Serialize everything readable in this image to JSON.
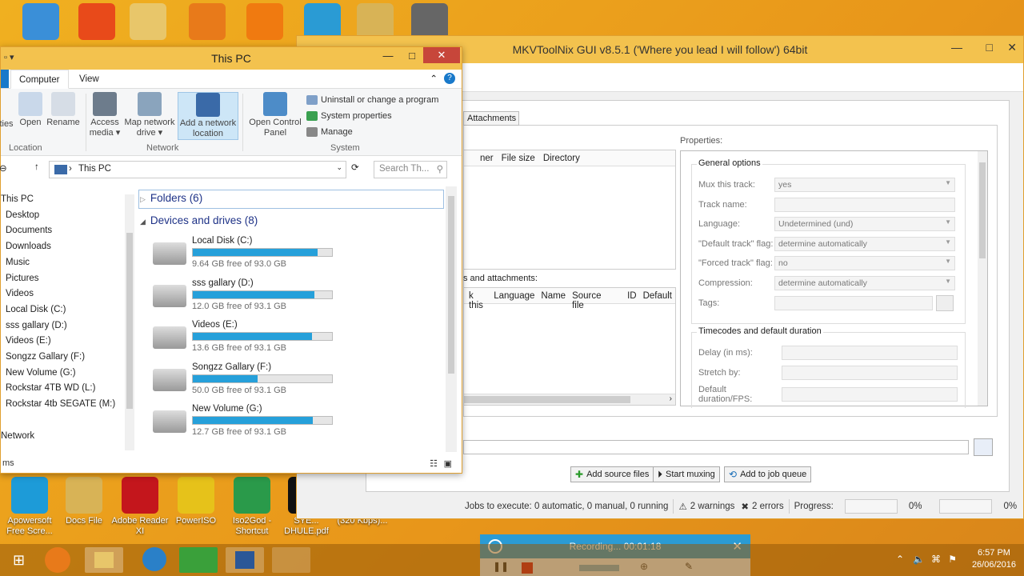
{
  "desktop_icons_top": [
    {
      "name": "computer-icon"
    },
    {
      "name": "rescue-icon"
    },
    {
      "name": "folder-icon"
    },
    {
      "name": "flash-icon"
    },
    {
      "name": "vlc-icon"
    },
    {
      "name": "lock-icon"
    },
    {
      "name": "folder-icon"
    },
    {
      "name": "film-reel-icon"
    }
  ],
  "desktop_icons_bottom": [
    {
      "label": "Apowersoft Free Scre...",
      "color": "#1d9bd8"
    },
    {
      "label": "Docs File",
      "color": "#d8b356"
    },
    {
      "label": "Adobe Reader XI",
      "color": "#c4161c"
    },
    {
      "label": "PowerISO",
      "color": "#e6c21a"
    },
    {
      "label": "Iso2God - Shortcut",
      "color": "#2a9a4a"
    },
    {
      "label": "SYE... DHULE.pdf",
      "color": "#111111"
    },
    {
      "label": "(320 Kbps)...",
      "color": "#d09a2a"
    }
  ],
  "mkv": {
    "title": "MKVToolNix GUI v8.5.1 ('Where you lead I will follow') 64bit",
    "tab_attachments": "Attachments",
    "files_headers": [
      "ner",
      "File size",
      "Directory"
    ],
    "tracks_label": "s and attachments:",
    "tracks_headers": [
      "k this",
      "Language",
      "Name",
      "Source file",
      "ID",
      "Default"
    ],
    "properties_label": "Properties:",
    "general_options": "General options",
    "rows": [
      {
        "label": "Mux this track:",
        "value": "yes",
        "dropdown": true
      },
      {
        "label": "Track name:",
        "value": "",
        "dropdown": false
      },
      {
        "label": "Language:",
        "value": "Undetermined (und)",
        "dropdown": true
      },
      {
        "label": "\"Default track\" flag:",
        "value": "determine automatically",
        "dropdown": true
      },
      {
        "label": "\"Forced track\" flag:",
        "value": "no",
        "dropdown": true
      },
      {
        "label": "Compression:",
        "value": "determine automatically",
        "dropdown": true
      },
      {
        "label": "Tags:",
        "value": "",
        "dropdown": false
      }
    ],
    "timecodes_title": "Timecodes and default duration",
    "timecode_rows": [
      {
        "label": "Delay (in ms):",
        "value": ""
      },
      {
        "label": "Stretch by:",
        "value": ""
      },
      {
        "label": "Default duration/FPS:",
        "value": ""
      }
    ],
    "btn_add_source": "Add source files",
    "btn_start_muxing": "Start muxing",
    "btn_add_queue": "Add to job queue",
    "status": {
      "jobs": "Jobs to execute:  0 automatic, 0 manual, 0 running",
      "warnings": "2 warnings",
      "errors": "2 errors",
      "progress_label": "Progress:",
      "progress1": "0%",
      "progress2": "0%"
    }
  },
  "explorer": {
    "title": "This PC",
    "tab_computer": "Computer",
    "tab_view": "View",
    "ribbon": {
      "properties": "ties",
      "open": "Open",
      "rename": "Rename",
      "access_media": "Access media ▾",
      "map_network": "Map network drive ▾",
      "add_network": "Add a network location",
      "open_control": "Open Control Panel",
      "uninstall": "Uninstall or change a program",
      "system_props": "System properties",
      "manage": "Manage",
      "group_location": "Location",
      "group_network": "Network",
      "group_system": "System"
    },
    "address": "This PC",
    "search_placeholder": "Search Th...",
    "nav": [
      "This PC",
      "Desktop",
      "Documents",
      "Downloads",
      "Music",
      "Pictures",
      "Videos",
      "Local Disk (C:)",
      "sss gallary (D:)",
      "Videos (E:)",
      "Songzz Gallary (F:)",
      "New Volume (G:)",
      "Rockstar 4TB WD (L:)",
      "Rockstar 4tb SEGATE (M:)",
      "",
      "Network"
    ],
    "folders_label": "Folders (6)",
    "devices_label": "Devices and drives (8)",
    "drives": [
      {
        "name": "Local Disk (C:)",
        "free": "9.64 GB free of 93.0 GB",
        "used": 0.896
      },
      {
        "name": "sss gallary (D:)",
        "free": "12.0 GB free of 93.1 GB",
        "used": 0.871
      },
      {
        "name": "Videos (E:)",
        "free": "13.6 GB free of 93.1 GB",
        "used": 0.854
      },
      {
        "name": "Songzz Gallary (F:)",
        "free": "50.0 GB free of 93.1 GB",
        "used": 0.463
      },
      {
        "name": "New Volume (G:)",
        "free": "12.7 GB free of 93.1 GB",
        "used": 0.864
      }
    ],
    "status_text": "ms"
  },
  "recording": {
    "text": "Recording... 00:01:18"
  },
  "tray": {
    "time": "6:57 PM",
    "date": "26/06/2016"
  }
}
